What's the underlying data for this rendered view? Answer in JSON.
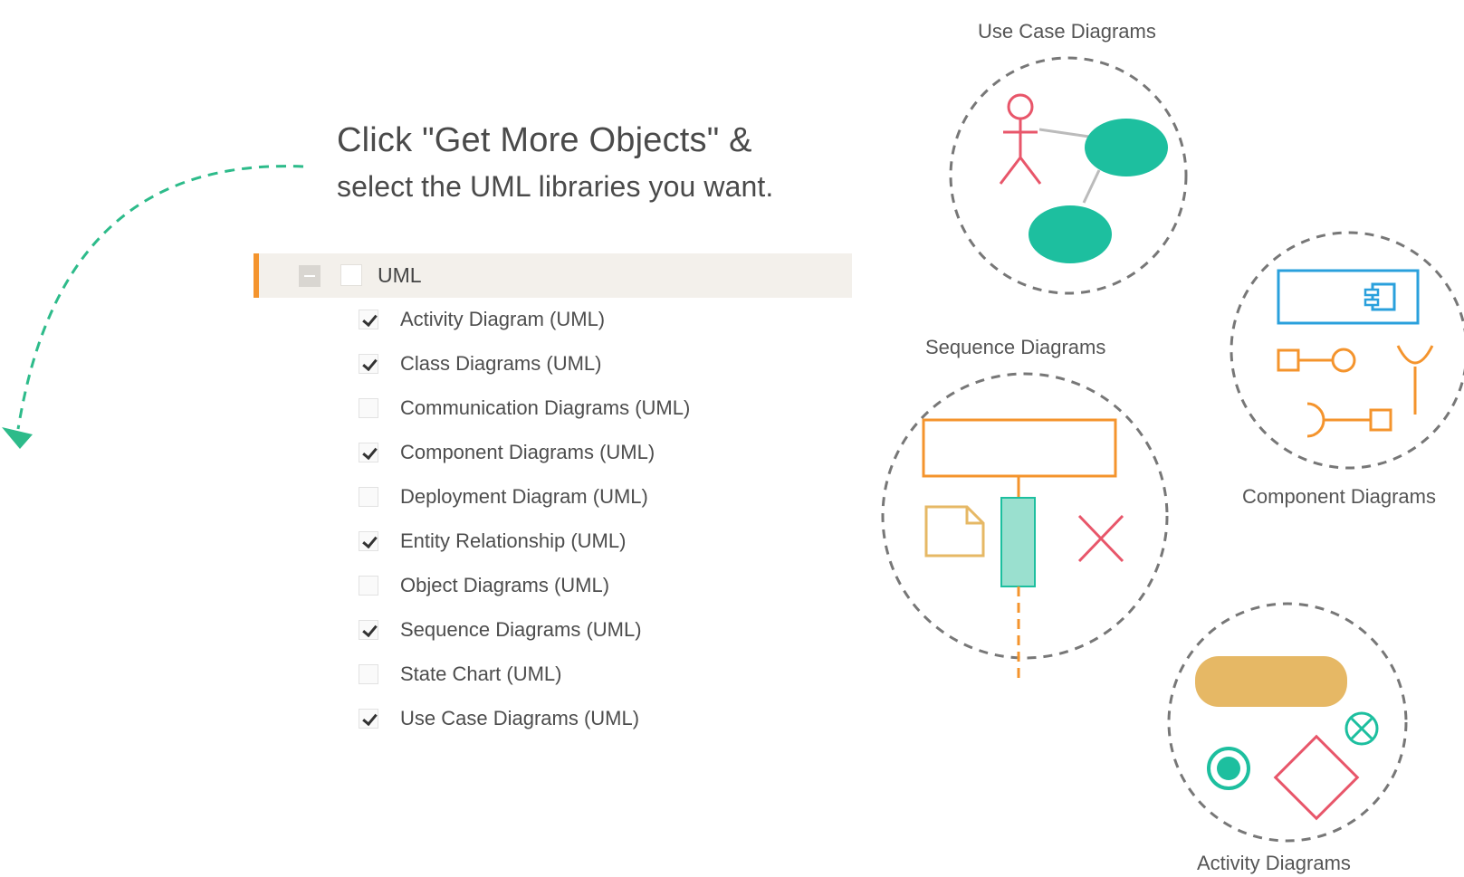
{
  "instruction": {
    "line1": "Click \"Get More Objects\" &",
    "line2": "select the UML libraries you want."
  },
  "library_group": {
    "label": "UML",
    "checked": false,
    "collapsed": false
  },
  "libraries": [
    {
      "label": "Activity Diagram (UML)",
      "checked": true
    },
    {
      "label": "Class Diagrams (UML)",
      "checked": true
    },
    {
      "label": "Communication Diagrams (UML)",
      "checked": false
    },
    {
      "label": "Component Diagrams (UML)",
      "checked": true
    },
    {
      "label": "Deployment Diagram (UML)",
      "checked": false
    },
    {
      "label": "Entity Relationship (UML)",
      "checked": true
    },
    {
      "label": "Object Diagrams (UML)",
      "checked": false
    },
    {
      "label": "Sequence Diagrams (UML)",
      "checked": true
    },
    {
      "label": "State Chart (UML)",
      "checked": false
    },
    {
      "label": "Use Case Diagrams (UML)",
      "checked": true
    }
  ],
  "diagram_examples": {
    "use_case": "Use Case Diagrams",
    "sequence": "Sequence Diagrams",
    "component": "Component Diagrams",
    "activity": "Activity Diagrams"
  },
  "colors": {
    "accent_orange": "#f4942d",
    "teal": "#1dbf9f",
    "arrow_green": "#2dbb8a",
    "red": "#e8566a",
    "blue": "#2aa0dc",
    "sand": "#e6b865",
    "mint": "#9ae0cf"
  }
}
